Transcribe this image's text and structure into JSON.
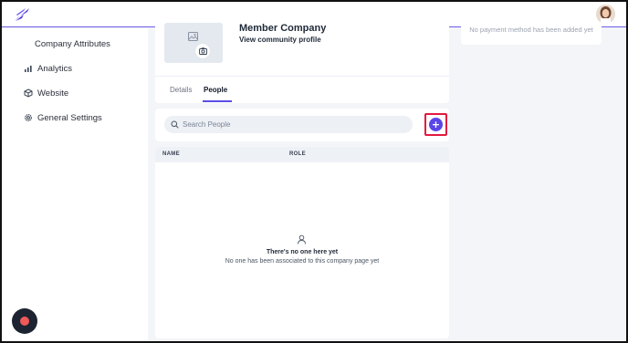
{
  "header": {
    "logo_icon": "feather-logo-icon",
    "avatar_icon": "user-avatar"
  },
  "sidebar": {
    "items": [
      {
        "label": "Company Attributes",
        "icon": ""
      },
      {
        "label": "Analytics",
        "icon": "bar-chart-icon"
      },
      {
        "label": "Website",
        "icon": "cube-icon"
      },
      {
        "label": "General Settings",
        "icon": "gear-icon"
      }
    ]
  },
  "profile": {
    "company_name": "Member Company",
    "community_link": "View community profile"
  },
  "tabs": [
    {
      "label": "Details",
      "active": false
    },
    {
      "label": "People",
      "active": true
    }
  ],
  "search": {
    "placeholder": "Search People"
  },
  "add_button": {
    "label": "+"
  },
  "table": {
    "columns": [
      "NAME",
      "ROLE"
    ],
    "empty_title": "There's no one here yet",
    "empty_subtitle": "No one has been associated to this company page yet"
  },
  "payment": {
    "text": "No payment method has been added yet"
  },
  "colors": {
    "accent": "#5a46e8",
    "highlight": "#e3193f",
    "background": "#f4f5f8"
  }
}
